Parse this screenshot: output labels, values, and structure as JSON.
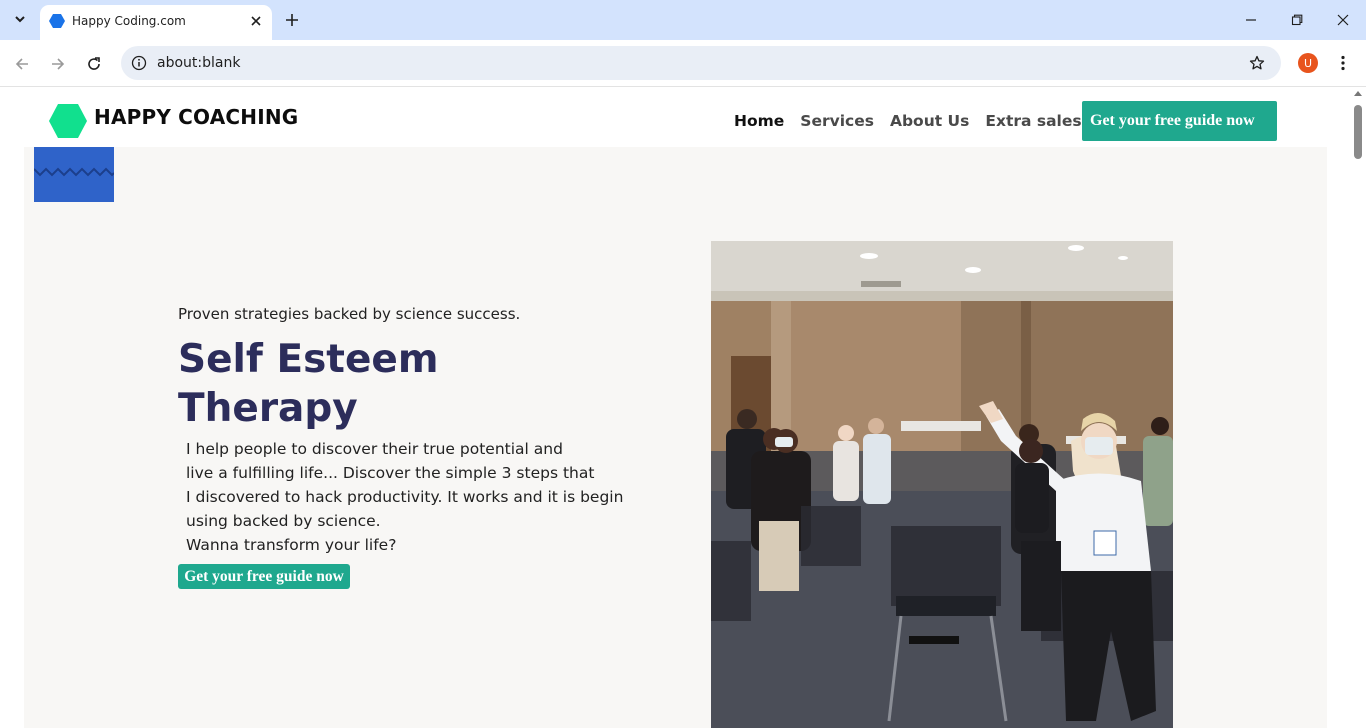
{
  "browser": {
    "tab_title": "Happy Coding.com",
    "url": "about:blank",
    "profile_initial": "U"
  },
  "header": {
    "logo_text": "HAPPY COACHING",
    "nav": [
      "Home",
      "Services",
      "About Us",
      "Extra salespage"
    ],
    "cta_label": "Get your free guide now"
  },
  "hero": {
    "subtitle": "Proven strategies backed by science success.",
    "title": "Self Esteem Therapy",
    "body_lines": [
      "I help people to discover their true potential and",
      "live a fulfilling life... Discover the simple 3 steps that",
      "I discovered to hack productivity. It works and it is begin",
      "using backed by science.",
      "Wanna transform your life?"
    ],
    "cta_label": "Get your free guide now"
  },
  "colors": {
    "accent": "#1fa88e",
    "logo": "#11e08e",
    "title": "#2c2d5b",
    "deco": "#2f63c9",
    "hero_bg": "#f8f7f5",
    "tabbar": "#d3e3fd"
  }
}
